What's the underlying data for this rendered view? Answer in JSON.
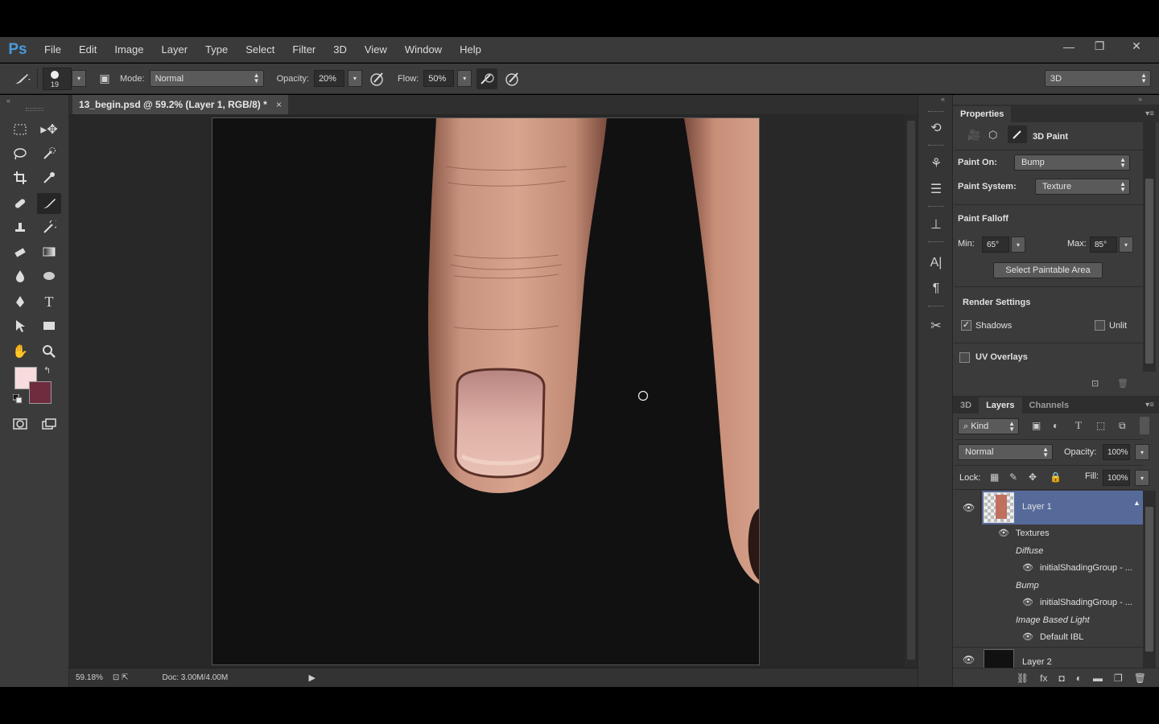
{
  "app": {
    "logo": "Ps",
    "menu": [
      "File",
      "Edit",
      "Image",
      "Layer",
      "Type",
      "Select",
      "Filter",
      "3D",
      "View",
      "Window",
      "Help"
    ],
    "window_controls": {
      "minimize": "—",
      "maximize": "❐",
      "close": "✕"
    }
  },
  "options": {
    "brush_size": "19",
    "mode_label": "Mode:",
    "mode_value": "Normal",
    "opacity_label": "Opacity:",
    "opacity_value": "20%",
    "flow_label": "Flow:",
    "flow_value": "50%",
    "workspace": "3D"
  },
  "document": {
    "tab_title": "13_begin.psd @ 59.2% (Layer 1, RGB/8) *",
    "close": "×"
  },
  "status": {
    "zoom": "59.18%",
    "doc_info": "Doc: 3.00M/4.00M",
    "arrow": "▶"
  },
  "colors": {
    "foreground": "#f6dcdc",
    "background": "#6f2c3e",
    "accent_selected_layer": "#566a9a"
  },
  "properties": {
    "tab": "Properties",
    "header": "3D Paint",
    "paint_on_label": "Paint On:",
    "paint_on_value": "Bump",
    "paint_system_label": "Paint System:",
    "paint_system_value": "Texture",
    "falloff_header": "Paint Falloff",
    "min_label": "Min:",
    "min_value": "65°",
    "max_label": "Max:",
    "max_value": "85°",
    "select_paintable": "Select Paintable Area",
    "render_header": "Render Settings",
    "shadows_label": "Shadows",
    "shadows_checked": true,
    "unlit_label": "Unlit",
    "uv_overlays_label": "UV Overlays"
  },
  "layers_panel": {
    "tabs": [
      "3D",
      "Layers",
      "Channels"
    ],
    "active_tab": "Layers",
    "filter_kind": "Kind",
    "blend_mode": "Normal",
    "opacity_label": "Opacity:",
    "opacity_value": "100%",
    "lock_label": "Lock:",
    "fill_label": "Fill:",
    "fill_value": "100%",
    "layers": [
      {
        "name": "Layer 1",
        "selected": true
      },
      {
        "name": "Textures"
      },
      {
        "name": "Diffuse"
      },
      {
        "name": "initialShadingGroup - ..."
      },
      {
        "name": "Bump"
      },
      {
        "name": "initialShadingGroup - ..."
      },
      {
        "name": "Image Based Light"
      },
      {
        "name": "Default IBL"
      },
      {
        "name": "Layer 2"
      }
    ]
  }
}
